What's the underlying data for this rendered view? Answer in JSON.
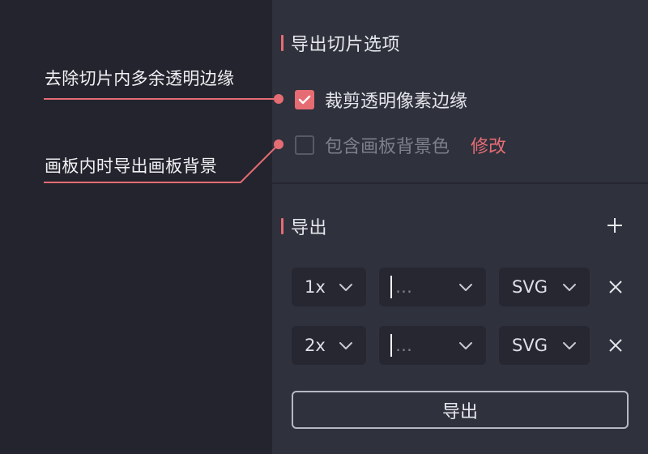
{
  "colors": {
    "accent": "#e56c72",
    "panel_bg": "#2f313d",
    "canvas_bg": "#24242e",
    "field_bg": "#262731"
  },
  "slice_options": {
    "title": "导出切片选项",
    "trim_transparent": {
      "label": "裁剪透明像素边缘",
      "checked": true
    },
    "include_artboard_bg": {
      "label": "包含画板背景色",
      "checked": false,
      "edit_label": "修改"
    }
  },
  "annotations": {
    "trim_note": "去除切片内多余透明边缘",
    "artboard_note": "画板内时导出画板背景"
  },
  "export": {
    "title": "导出",
    "add_icon": "plus-icon",
    "rows": [
      {
        "scale": "1x",
        "suffix_placeholder": "…",
        "format": "SVG"
      },
      {
        "scale": "2x",
        "suffix_placeholder": "…",
        "format": "SVG"
      }
    ],
    "button_label": "导出"
  }
}
